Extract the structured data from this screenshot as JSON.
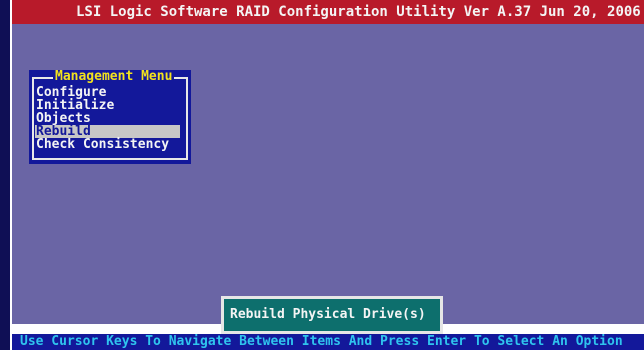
{
  "header": {
    "title": "LSI Logic Software RAID Configuration Utility Ver A.37 Jun 20, 2006"
  },
  "menu": {
    "title": "Management Menu",
    "items": [
      {
        "label": "Configure"
      },
      {
        "label": "Initialize"
      },
      {
        "label": "Objects"
      },
      {
        "label": "Rebuild"
      },
      {
        "label": "Check Consistency"
      }
    ],
    "selected": "Rebuild"
  },
  "help": {
    "text": "Rebuild Physical Drive(s)"
  },
  "status_bar": {
    "text": "Use Cursor Keys To Navigate Between Items And Press Enter To Select An Option"
  },
  "colors": {
    "title_bar_bg": "#b81a2a",
    "desktop_bg": "#6a65a5",
    "menu_bg": "#13189a",
    "menu_title": "#f2e21e",
    "selection_bg": "#c7c7c7",
    "help_bg": "#0d6f6d",
    "status_text": "#2fc4ee"
  }
}
